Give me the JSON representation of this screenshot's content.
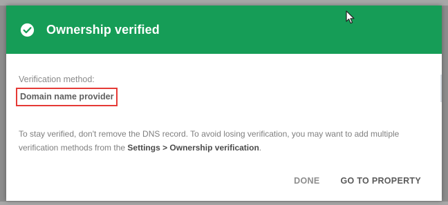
{
  "dialog": {
    "title": "Ownership verified",
    "header_color": "#169d57",
    "method_label": "Verification method:",
    "method_value": "Domain name provider",
    "highlight_color": "#e53935",
    "info_prefix": "To stay verified, don't remove the DNS record. To avoid losing verification, you may want to add multiple verification methods from the ",
    "info_bold": "Settings > Ownership verification",
    "info_suffix": ".",
    "done_label": "DONE",
    "property_label": "GO TO PROPERTY"
  },
  "icons": {
    "header": "check-circle-icon",
    "pointer": "mouse-cursor-icon"
  }
}
